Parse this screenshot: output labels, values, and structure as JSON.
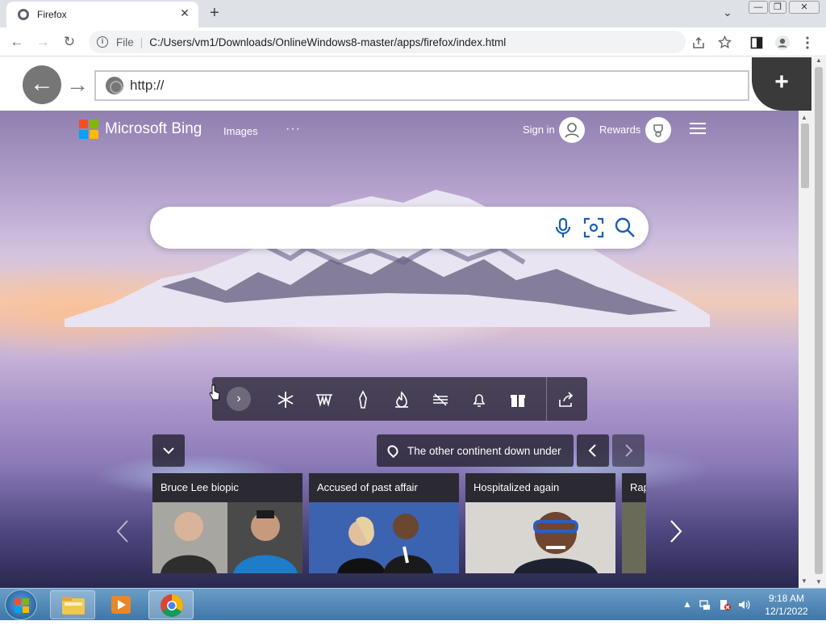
{
  "browser": {
    "tab_title": "Firefox",
    "tab_close": "✕",
    "new_tab": "+",
    "tab_dropdown": "⌄",
    "window_controls": {
      "minimize": "—",
      "maximize": "❐",
      "close": "✕"
    },
    "address_prefix": "File",
    "address_url": "C:/Users/vm1/Downloads/OnlineWindows8-master/apps/firefox/index.html",
    "nav": {
      "back": "←",
      "forward": "→",
      "reload": "↻"
    },
    "toolbar_icons": [
      "share-icon",
      "star-icon",
      "sidebar-icon",
      "profile-icon",
      "kebab-menu-icon"
    ]
  },
  "app": {
    "back_glyph": "←",
    "forward_glyph": "→",
    "url_value": "http://",
    "new_tab_glyph": "+"
  },
  "bing": {
    "logo_text": "Microsoft Bing",
    "logo_colors": [
      "#f25022",
      "#7fba00",
      "#00a4ef",
      "#ffb900"
    ],
    "nav_images": "Images",
    "nav_more": "···",
    "sign_in": "Sign in",
    "rewards": "Rewards",
    "search_placeholder": "",
    "search_icons": [
      "microphone-icon",
      "visual-search-icon",
      "search-icon"
    ],
    "accent_color": "#1a5fb4",
    "homepage_icons": [
      "snowflake-icon",
      "landscape-icon",
      "pen-icon",
      "fire-icon",
      "waves-icon",
      "bell-icon",
      "gift-icon"
    ],
    "location_caption": "The other continent down under",
    "news_cards": [
      {
        "title": "Bruce Lee biopic"
      },
      {
        "title": "Accused of past affair"
      },
      {
        "title": "Hospitalized again"
      },
      {
        "title": "Rap"
      }
    ]
  },
  "taskbar": {
    "clock_time": "9:18 AM",
    "clock_date": "12/1/2022",
    "tray_arrow": "▲"
  }
}
